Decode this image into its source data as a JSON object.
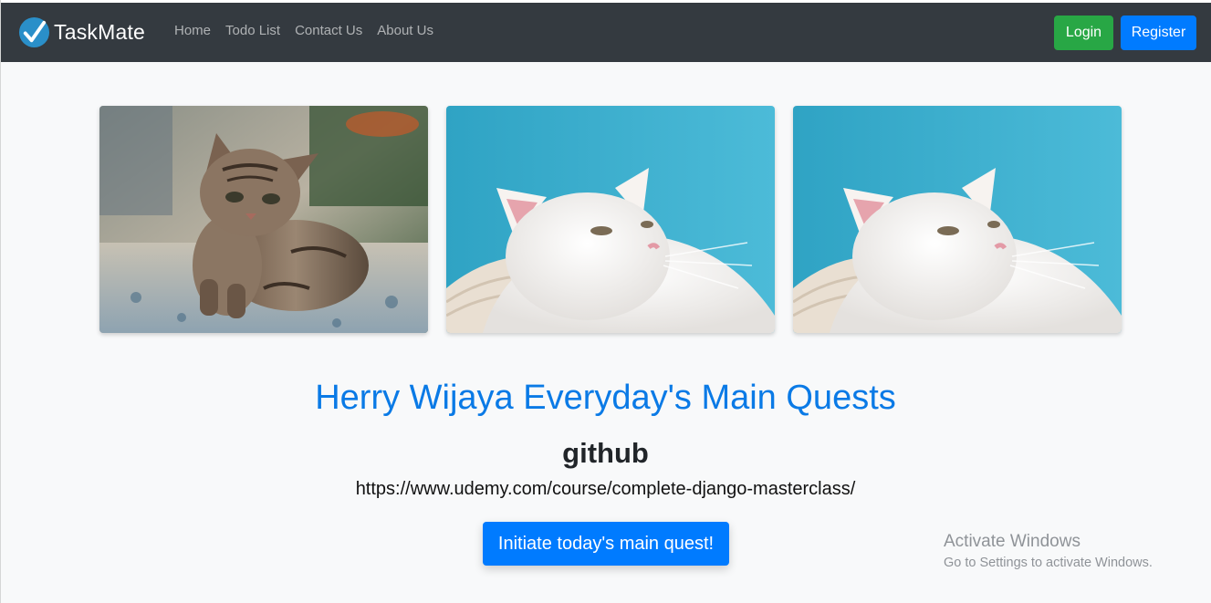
{
  "navbar": {
    "brand": "TaskMate",
    "links": [
      {
        "label": "Home"
      },
      {
        "label": "Todo List"
      },
      {
        "label": "Contact Us"
      },
      {
        "label": "About Us"
      }
    ],
    "login_label": "Login",
    "register_label": "Register"
  },
  "gallery": {
    "images": [
      {
        "subject": "tabby-kitten"
      },
      {
        "subject": "white-cat"
      },
      {
        "subject": "white-cat"
      }
    ]
  },
  "hero": {
    "title": "Herry Wijaya Everyday's Main Quests",
    "subtitle": "github",
    "link": "https://www.udemy.com/course/complete-django-masterclass/",
    "cta_label": "Initiate today's main quest!"
  },
  "watermark": {
    "title": "Activate Windows",
    "subtitle": "Go to Settings to activate Windows."
  },
  "colors": {
    "navbar": "#343a40",
    "primary": "#007bff",
    "success": "#28a745",
    "title": "#0a7ae6"
  }
}
